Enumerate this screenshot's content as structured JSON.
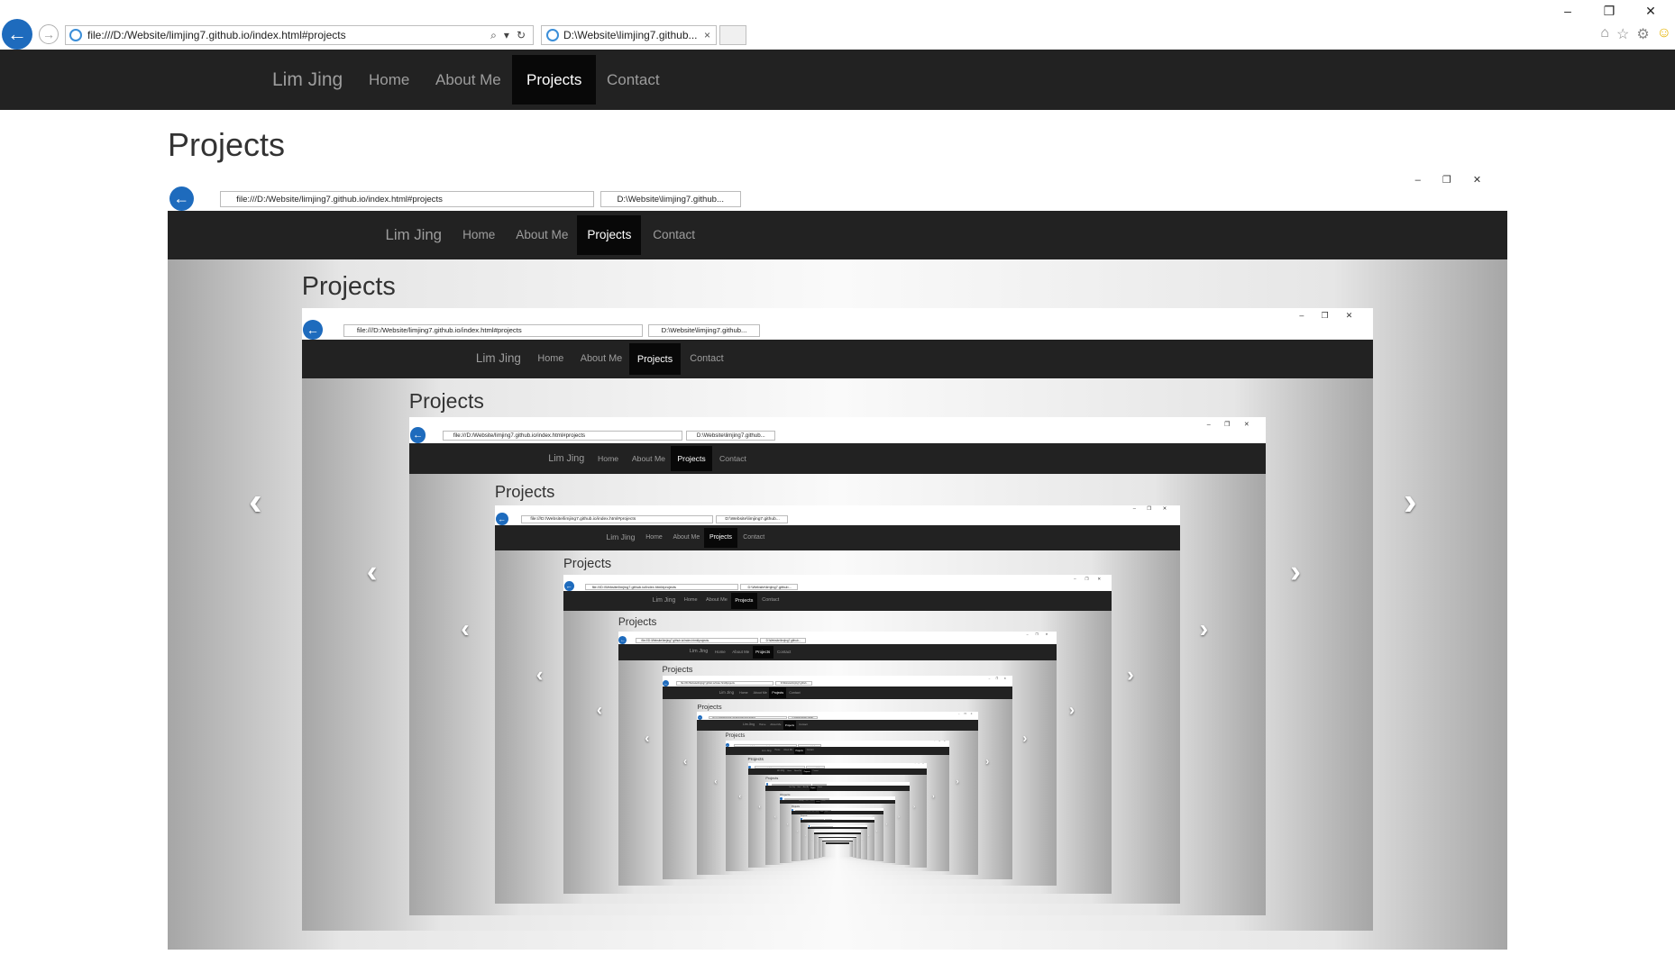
{
  "browser": {
    "address": "file:///D:/Website/limjing7.github.io/index.html#projects",
    "tab_title": "D:\\Website\\limjing7.github...",
    "tab_close": "×",
    "back_glyph": "←",
    "forward_glyph": "→",
    "window_controls": [
      "–",
      "❐",
      "✕"
    ],
    "toolbar_icons": [
      "home-icon",
      "star-icon",
      "gear-icon",
      "smiley-icon"
    ]
  },
  "navbar": {
    "brand": "Lim Jing",
    "items": [
      {
        "label": "Home",
        "active": false
      },
      {
        "label": "About Me",
        "active": false
      },
      {
        "label": "Projects",
        "active": true
      },
      {
        "label": "Contact",
        "active": false
      }
    ]
  },
  "page": {
    "title": "Projects"
  },
  "carousel": {
    "prev_glyph": "‹",
    "next_glyph": "›"
  },
  "colors": {
    "navbar_bg": "#222222",
    "navbar_active_bg": "#080808",
    "navbar_text": "#9d9d9d",
    "ie_blue": "#1e6bbd"
  }
}
